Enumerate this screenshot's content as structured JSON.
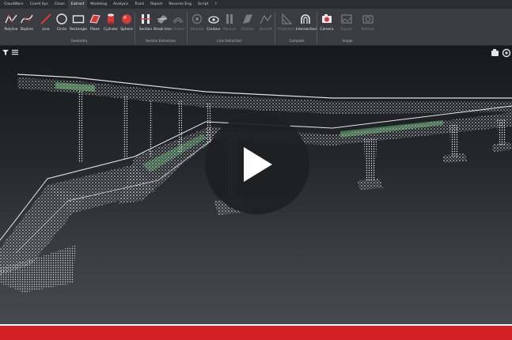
{
  "menu": [
    "CloudWorx",
    "Coord Sys",
    "Clean",
    "Extract",
    "Modeling",
    "Analysis",
    "Track",
    "Report",
    "Reverse Eng",
    "Script",
    "?"
  ],
  "active_menu_index": 3,
  "tools": [
    {
      "label": "Polyline",
      "icon": "polyline-icon",
      "enabled": true
    },
    {
      "label": "Bspline",
      "icon": "bspline-icon",
      "enabled": true
    },
    {
      "label": "Line",
      "icon": "line-icon",
      "enabled": true
    },
    {
      "label": "Circle",
      "icon": "circle-icon",
      "enabled": true
    },
    {
      "label": "Rectangle",
      "icon": "rectangle-icon",
      "enabled": true
    },
    {
      "label": "Plane",
      "icon": "plane-icon",
      "enabled": true
    },
    {
      "label": "Cylinder",
      "icon": "cylinder-icon",
      "enabled": true
    },
    {
      "label": "Sphere",
      "icon": "sphere-icon",
      "enabled": true
    },
    {
      "label": "Section",
      "icon": "section-icon",
      "enabled": true
    },
    {
      "label": "Break line",
      "icon": "break-line-icon",
      "enabled": true
    },
    {
      "label": "Contour",
      "icon": "contour-icon",
      "enabled": false
    },
    {
      "label": "Nearest",
      "icon": "nearest-icon",
      "enabled": false
    },
    {
      "label": "Contour",
      "icon": "contour-extract-icon",
      "enabled": false
    },
    {
      "label": "Manual",
      "icon": "manual-icon",
      "enabled": false
    },
    {
      "label": "Outline",
      "icon": "outline-icon",
      "enabled": false
    },
    {
      "label": "Smooth",
      "icon": "smooth-icon",
      "enabled": false
    },
    {
      "label": "Projection",
      "icon": "projection-icon",
      "enabled": false
    },
    {
      "label": "Intersection",
      "icon": "intersection-icon",
      "enabled": true
    },
    {
      "label": "Camera",
      "icon": "camera-icon",
      "enabled": true
    },
    {
      "label": "Export",
      "icon": "export-icon",
      "enabled": false
    },
    {
      "label": "Refresh",
      "icon": "refresh-icon",
      "enabled": false
    }
  ],
  "groups": [
    "Geometry",
    "Section Extraction",
    "Line Extraction",
    "Compute",
    "Image"
  ],
  "colors": {
    "menubar": "#2b2d31",
    "ribbon": "#3a3c41",
    "viewport_top": "#17191c",
    "viewport_bottom": "#46494e",
    "play_button": "#1e1f22",
    "brand_red": "#d41f26",
    "point_cloud": "#e8ebee",
    "scan_highlight": "#7fd08a"
  },
  "viewport": {
    "menu_icon": "hamburger-menu-icon",
    "filter_icon": "filter-icon",
    "nav_icons": [
      "orbit-icon",
      "walk-icon"
    ]
  },
  "video": {
    "play_icon": "play-icon"
  }
}
